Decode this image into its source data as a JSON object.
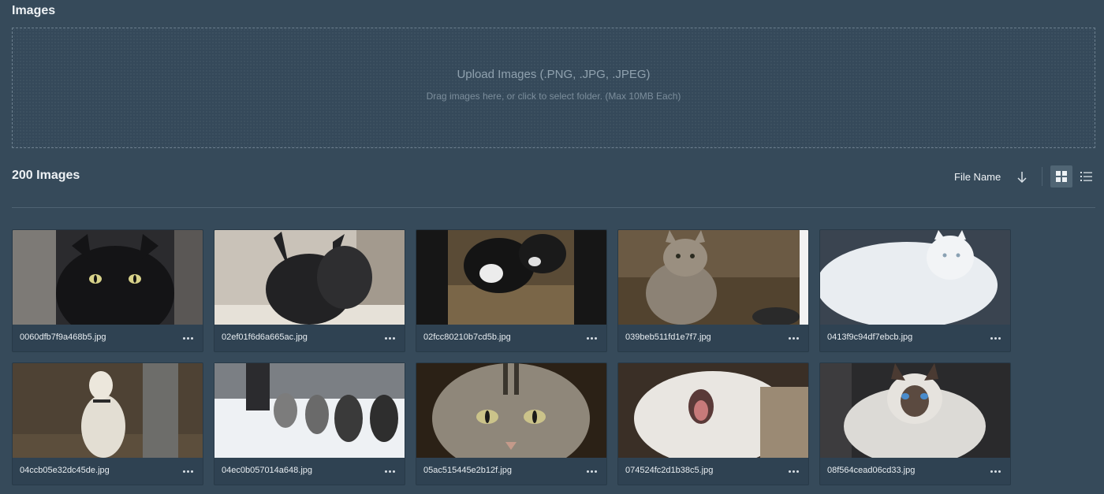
{
  "section": {
    "title": "Images"
  },
  "upload": {
    "title": "Upload Images (.PNG, .JPG, .JPEG)",
    "subtitle": "Drag images here, or click to select folder. (Max 10MB Each)"
  },
  "gallery": {
    "count_label": "200 Images",
    "sort_label": "File Name",
    "sort_direction_icon": "arrow-down-icon",
    "view_modes": [
      "grid-view-icon",
      "list-view-icon"
    ],
    "active_view": "grid",
    "accent_color": "#506574"
  },
  "images": [
    {
      "filename": "0060dfb7f9a468b5.jpg"
    },
    {
      "filename": "02ef01f6d6a665ac.jpg"
    },
    {
      "filename": "02fcc80210b7cd5b.jpg"
    },
    {
      "filename": "039beb511fd1e7f7.jpg"
    },
    {
      "filename": "0413f9c94df7ebcb.jpg"
    },
    {
      "filename": "04ccb05e32dc45de.jpg"
    },
    {
      "filename": "04ec0b057014a648.jpg"
    },
    {
      "filename": "05ac515445e2b12f.jpg"
    },
    {
      "filename": "074524fc2d1b38c5.jpg"
    },
    {
      "filename": "08f564cead06cd33.jpg"
    }
  ]
}
